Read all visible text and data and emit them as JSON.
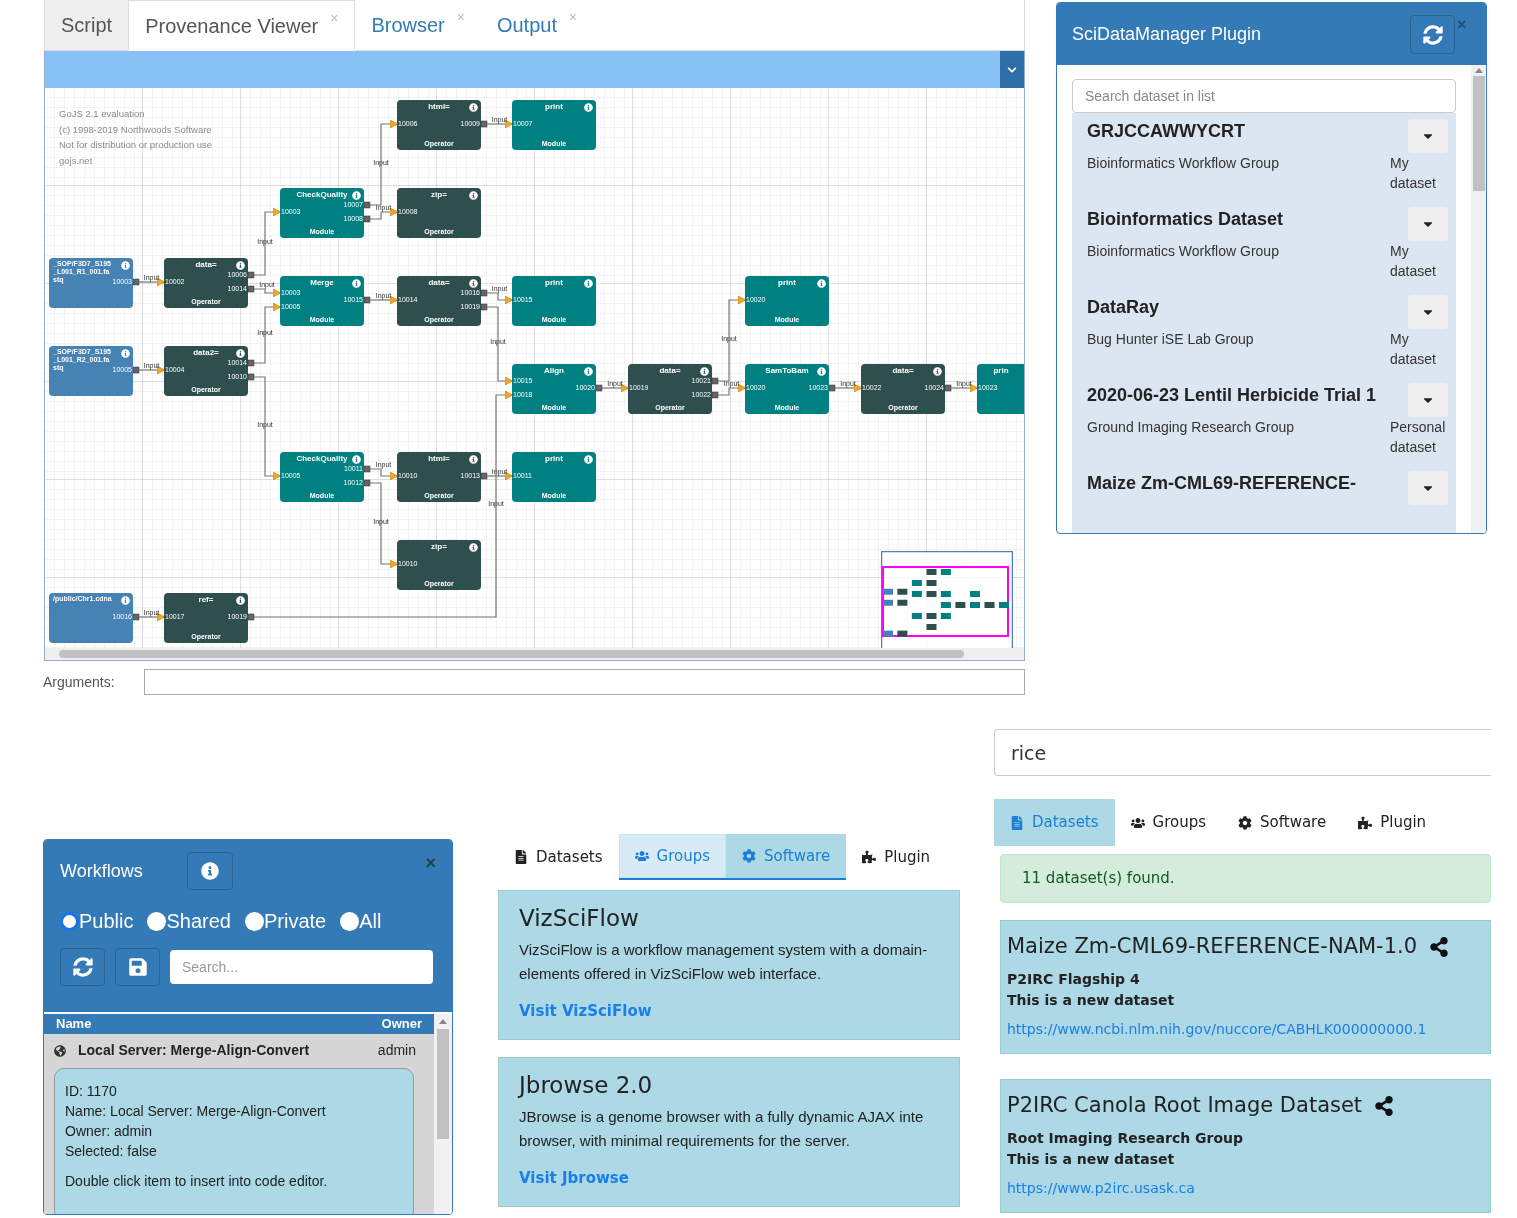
{
  "editor": {
    "tabs": [
      {
        "label": "Script",
        "selected": false,
        "muted": true
      },
      {
        "label": "Provenance Viewer",
        "selected": true,
        "muted": false,
        "close": "×"
      },
      {
        "label": "Browser",
        "selected": false,
        "muted": false,
        "close": "×"
      },
      {
        "label": "Output",
        "selected": false,
        "muted": false,
        "close": "×"
      }
    ],
    "diagram": {
      "notice_lines": [
        "GoJS 2.1 evaluation",
        "(c) 1998-2019 Northwoods Software",
        "Not for distribution or production use",
        "gojs.net"
      ],
      "nodes": [
        {
          "kind": "operator",
          "title": "html=",
          "type_label": "Operator",
          "inputs": [
            "10006"
          ],
          "outputs": [
            "10009"
          ]
        },
        {
          "kind": "module",
          "title": "print",
          "type_label": "Module",
          "inputs": [
            "10007"
          ]
        },
        {
          "kind": "module",
          "title": "CheckQuality",
          "type_label": "Module",
          "inputs": [
            "10003"
          ],
          "outputs": [
            "10007",
            "10008"
          ]
        },
        {
          "kind": "operator",
          "title": "zip=",
          "type_label": "Operator",
          "inputs": [
            "10008"
          ]
        },
        {
          "kind": "data",
          "title": "_SOP/F3D7_S195_L001_R1_001.fastq",
          "outputs": [
            "10003"
          ]
        },
        {
          "kind": "operator",
          "title": "data=",
          "type_label": "Operator",
          "inputs": [
            "10002"
          ],
          "outputs": [
            "10006",
            "10014"
          ]
        },
        {
          "kind": "module",
          "title": "Merge",
          "type_label": "Module",
          "inputs": [
            "10003",
            "10005"
          ],
          "outputs": [
            "10015"
          ]
        },
        {
          "kind": "operator",
          "title": "data=",
          "type_label": "Operator",
          "inputs": [
            "10014"
          ],
          "outputs": [
            "10016",
            "10019"
          ]
        },
        {
          "kind": "module",
          "title": "print",
          "type_label": "Module",
          "inputs": [
            "10015"
          ]
        },
        {
          "kind": "module",
          "title": "print",
          "type_label": "Module",
          "inputs": [
            "10020"
          ]
        },
        {
          "kind": "data",
          "title": "_SOP/F3D7_S195_L001_R2_001.fastq",
          "outputs": [
            "10005"
          ]
        },
        {
          "kind": "operator",
          "title": "data2=",
          "type_label": "Operator",
          "inputs": [
            "10004"
          ],
          "outputs": [
            "10014",
            "10010"
          ]
        },
        {
          "kind": "module",
          "title": "Align",
          "type_label": "Module",
          "inputs": [
            "10015",
            "10018"
          ],
          "outputs": [
            "10020"
          ]
        },
        {
          "kind": "operator",
          "title": "data=",
          "type_label": "Operator",
          "inputs": [
            "10019"
          ],
          "outputs": [
            "10021",
            "10022"
          ]
        },
        {
          "kind": "module",
          "title": "SamToBam",
          "type_label": "Module",
          "inputs": [
            "10020"
          ],
          "outputs": [
            "10023"
          ]
        },
        {
          "kind": "operator",
          "title": "data=",
          "type_label": "Operator",
          "inputs": [
            "10022"
          ],
          "outputs": [
            "10024"
          ]
        },
        {
          "kind": "module",
          "title": "prin",
          "inputs": [
            "10023"
          ]
        },
        {
          "kind": "module",
          "title": "CheckQuality",
          "type_label": "Module",
          "inputs": [
            "10005"
          ],
          "outputs": [
            "10011",
            "10012"
          ]
        },
        {
          "kind": "operator",
          "title": "html=",
          "type_label": "Operator",
          "inputs": [
            "10010"
          ],
          "outputs": [
            "10013"
          ]
        },
        {
          "kind": "module",
          "title": "print",
          "type_label": "Module",
          "inputs": [
            "10011"
          ]
        },
        {
          "kind": "operator",
          "title": "zip=",
          "type_label": "Operator",
          "inputs": [
            "10010"
          ]
        },
        {
          "kind": "data",
          "title": "/public/Chr1.cdna",
          "outputs": [
            "10016"
          ]
        },
        {
          "kind": "operator",
          "title": "ref=",
          "type_label": "Operator",
          "inputs": [
            "10017"
          ],
          "outputs": [
            "10019"
          ]
        }
      ],
      "edges": [
        {
          "label": "Input"
        },
        {
          "label": "Input"
        },
        {
          "label": "Input"
        },
        {
          "label": "Input"
        },
        {
          "label": "Input"
        },
        {
          "label": "Input"
        },
        {
          "label": "Input"
        },
        {
          "label": "Input"
        },
        {
          "label": "Input"
        },
        {
          "label": "Input"
        },
        {
          "label": "Input"
        },
        {
          "label": "Input"
        },
        {
          "label": "Input"
        },
        {
          "label": "Input"
        },
        {
          "label": "Input"
        },
        {
          "label": "Input"
        },
        {
          "label": "Input"
        },
        {
          "label": "Input"
        },
        {
          "label": "Input"
        },
        {
          "label": "Input"
        },
        {
          "label": "Input"
        },
        {
          "label": "Input"
        }
      ]
    },
    "arguments": {
      "label": "Arguments:"
    }
  },
  "plugin": {
    "title": "SciDataManager Plugin",
    "close": "×",
    "search_placeholder": "Search dataset in list",
    "datasets": [
      {
        "name": "GRJCCAWWYCRT",
        "group": "Bioinformatics Workflow Group",
        "ownership": "My dataset"
      },
      {
        "name": "Bioinformatics Dataset",
        "group": "Bioinformatics Workflow Group",
        "ownership": "My dataset"
      },
      {
        "name": "DataRay",
        "group": "Bug Hunter iSE Lab Group",
        "ownership": "My dataset"
      },
      {
        "name": "2020-06-23 Lentil Herbicide Trial 1",
        "group": "Ground Imaging Research Group",
        "ownership": "Personal dataset"
      },
      {
        "name": "Maize Zm-CML69-REFERENCE-"
      }
    ]
  },
  "workflows": {
    "title": "Workflows",
    "close": "×",
    "visibility": [
      {
        "label": "Public",
        "selected": true
      },
      {
        "label": "Shared",
        "selected": false
      },
      {
        "label": "Private",
        "selected": false
      },
      {
        "label": "All",
        "selected": false
      }
    ],
    "search_placeholder": "Search...",
    "columns": [
      "Name",
      "Owner"
    ],
    "rows": [
      {
        "name": "Local Server: Merge-Align-Convert",
        "owner": "admin"
      }
    ],
    "details": [
      "ID: 1170",
      "Name: Local Server: Merge-Align-Convert",
      "Owner: admin",
      "Selected: false"
    ],
    "hint": "Double click item to insert into code editor."
  },
  "software": {
    "tabs": [
      {
        "label": "Datasets",
        "kind": "file",
        "selected": false,
        "hovered": false
      },
      {
        "label": "Groups",
        "kind": "users",
        "selected": false,
        "hovered": true
      },
      {
        "label": "Software",
        "kind": "gear",
        "selected": true,
        "hovered": false
      },
      {
        "label": "Plugin",
        "kind": "puzzle",
        "selected": false,
        "hovered": false
      }
    ],
    "cards": [
      {
        "title": "VizSciFlow",
        "lines": [
          "VizSciFlow is a workflow management system with a domain-",
          "elements offered in VizSciFlow web interface."
        ],
        "link": "Visit VizSciFlow"
      },
      {
        "title": "Jbrowse 2.0",
        "lines": [
          "JBrowse is a genome browser with a fully dynamic AJAX inte",
          "browser, with minimal requirements for the server."
        ],
        "link": "Visit Jbrowse"
      }
    ]
  },
  "dataset_search": {
    "query": "rice",
    "tabs": [
      {
        "label": "Datasets",
        "kind": "file",
        "selected": true
      },
      {
        "label": "Groups",
        "kind": "users",
        "selected": false
      },
      {
        "label": "Software",
        "kind": "gear",
        "selected": false
      },
      {
        "label": "Plugin",
        "kind": "puzzle",
        "selected": false
      }
    ],
    "result_count": "11 dataset(s) found.",
    "results": [
      {
        "title": "Maize Zm-CML69-REFERENCE-NAM-1.0",
        "group": "P2IRC Flagship 4",
        "description": "This is a new dataset",
        "url": "https://www.ncbi.nlm.nih.gov/nuccore/CABHLK000000000.1"
      },
      {
        "title": "P2IRC Canola Root Image Dataset",
        "group": "Root Imaging Research Group",
        "description": "This is a new dataset",
        "url": "https://www.p2irc.usask.ca"
      }
    ]
  }
}
